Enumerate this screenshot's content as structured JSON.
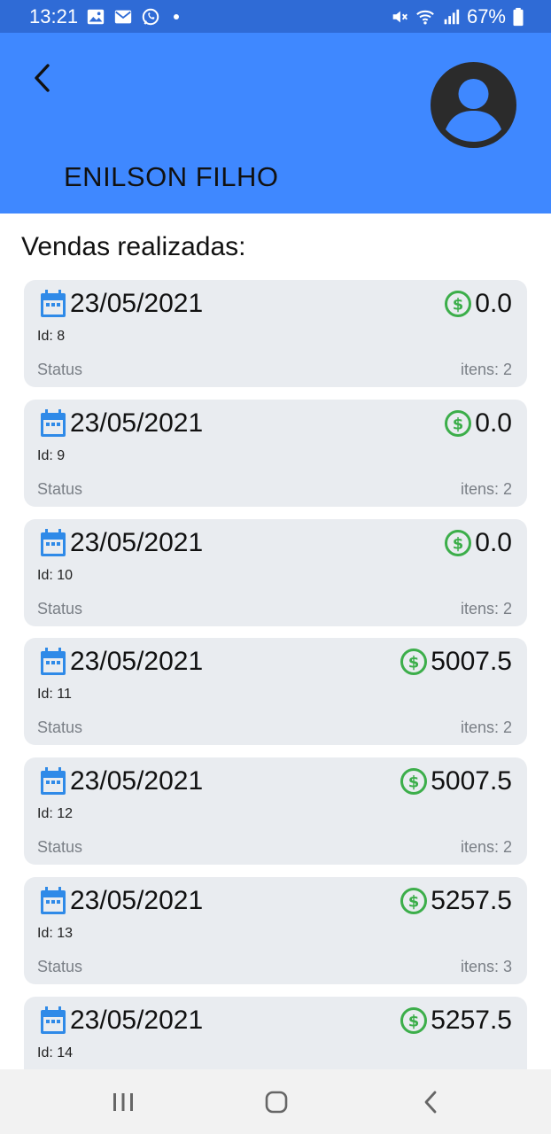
{
  "status_bar": {
    "time": "13:21",
    "battery": "67%",
    "left_icons": [
      "image-icon",
      "email-icon",
      "whatsapp-icon"
    ],
    "right_icons": [
      "mute-icon",
      "wifi-icon",
      "signal-icon",
      "battery-icon"
    ]
  },
  "header": {
    "user_name": "ENILSON FILHO",
    "background_color": "#3f88ff"
  },
  "section_title": "Vendas realizadas:",
  "sales": [
    {
      "date": "23/05/2021",
      "amount": "0.0",
      "id": "Id: 8",
      "status": "Status",
      "items": "itens: 2"
    },
    {
      "date": "23/05/2021",
      "amount": "0.0",
      "id": "Id: 9",
      "status": "Status",
      "items": "itens: 2"
    },
    {
      "date": "23/05/2021",
      "amount": "0.0",
      "id": "Id: 10",
      "status": "Status",
      "items": "itens: 2"
    },
    {
      "date": "23/05/2021",
      "amount": "5007.5",
      "id": "Id: 11",
      "status": "Status",
      "items": "itens: 2"
    },
    {
      "date": "23/05/2021",
      "amount": "5007.5",
      "id": "Id: 12",
      "status": "Status",
      "items": "itens: 2"
    },
    {
      "date": "23/05/2021",
      "amount": "5257.5",
      "id": "Id: 13",
      "status": "Status",
      "items": "itens: 3"
    },
    {
      "date": "23/05/2021",
      "amount": "5257.5",
      "id": "Id: 14",
      "status": "",
      "items": ""
    }
  ],
  "colors": {
    "status_bar": "#2f6bd6",
    "card_background": "#e9ecf0",
    "calendar_icon": "#2f8ae8",
    "money_icon": "#3cae4a"
  },
  "nav_bar": {
    "icons": [
      "recent-apps-icon",
      "home-icon",
      "back-icon"
    ]
  }
}
